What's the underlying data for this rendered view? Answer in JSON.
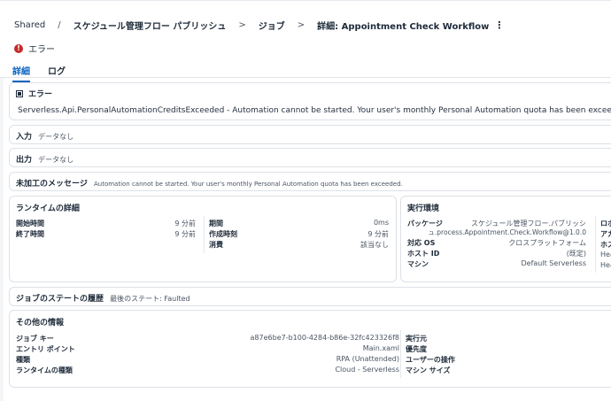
{
  "breadcrumb": {
    "items": [
      "Shared",
      "スケジュール管理フロー パブリッシュ",
      "ジョブ",
      "詳細: Appointment Check Workflow"
    ],
    "separators": [
      "/",
      ">",
      ">"
    ]
  },
  "status": {
    "label": "エラー",
    "color": "#c62828"
  },
  "tabs": [
    {
      "label": "詳細",
      "active": true
    },
    {
      "label": "ログ",
      "active": false
    }
  ],
  "error_card": {
    "title": "エラー",
    "message": "Serverless.Api.PersonalAutomationCreditsExceeded - Automation cannot be started. Your user's monthly Personal Automation quota has been exceeded."
  },
  "input": {
    "label": "入力",
    "value": "データなし"
  },
  "output": {
    "label": "出力",
    "value": "データなし"
  },
  "raw_message": {
    "label": "未加工のメッセージ",
    "value": "Automation cannot be started. Your user's monthly Personal Automation quota has been exceeded."
  },
  "runtime": {
    "title": "ランタイムの詳細",
    "left": [
      {
        "label": "開始時間",
        "value": "9 分前"
      },
      {
        "label": "終了時間",
        "value": "9 分前"
      }
    ],
    "right": [
      {
        "label": "期間",
        "value": "0ms"
      },
      {
        "label": "作成時刻",
        "value": "9 分前"
      },
      {
        "label": "消費",
        "value": "該当なし"
      }
    ]
  },
  "environment": {
    "title": "実行環境",
    "rows": [
      {
        "label": "パッケージ",
        "value_line1": "スケジュール管理フロー.パブリッシ",
        "value_line2": "ュ.process.Appointment.Check.Workflow@1.0.0"
      },
      {
        "label": "対応 OS",
        "value": "クロスプラットフォーム"
      },
      {
        "label": "ホスト ID",
        "value": "(既定)"
      },
      {
        "label": "マシン",
        "value": "Default Serverless"
      }
    ],
    "overflow_labels": [
      "ロボ",
      "アカ",
      "ホス",
      "Hea",
      "Hea"
    ]
  },
  "state_history": {
    "label": "ジョブのステートの履歴",
    "value": "最後のステート: Faulted"
  },
  "other_info": {
    "title": "その他の情報",
    "rows": [
      {
        "label": "ジョブ キー",
        "value": "a87e6be7-b100-4284-b86e-32fc423326f8"
      },
      {
        "label": "エントリ ポイント",
        "value": "Main.xaml"
      },
      {
        "label": "種類",
        "value": "RPA (Unattended)"
      },
      {
        "label": "ランタイムの種類",
        "value": "Cloud - Serverless"
      }
    ],
    "right_labels": [
      "実行元",
      "優先度",
      "ユーザーの操作",
      "マシン サイズ"
    ]
  },
  "icons": {
    "status": "error-circle-icon",
    "error_card": "error-square-icon",
    "more": "kebab-icon"
  }
}
